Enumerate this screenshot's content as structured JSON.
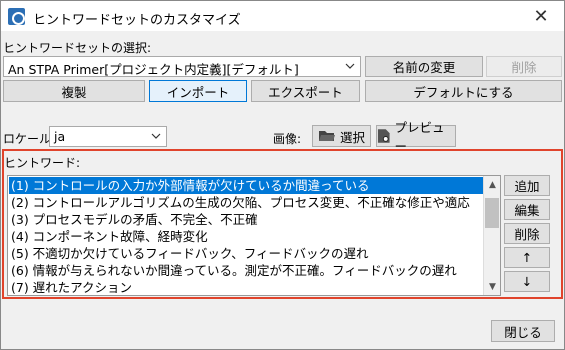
{
  "window": {
    "title": "ヒントワードセットのカスタマイズ"
  },
  "set_selection": {
    "label": "ヒントワードセットの選択:",
    "value": "An STPA Primer[プロジェクト内定義][デフォルト]",
    "rename_label": "名前の変更",
    "delete_label": "削除"
  },
  "toolbar": {
    "duplicate_label": "複製",
    "import_label": "インポート",
    "export_label": "エクスポート",
    "default_label": "デフォルトにする"
  },
  "locale": {
    "label": "ロケール:",
    "value": "ja"
  },
  "image": {
    "label": "画像:",
    "select_label": "選択",
    "preview_label": "プレビュー"
  },
  "hint_words": {
    "label": "ヒントワード:",
    "items": [
      "(1) コントロールの入力か外部情報が欠けているか間違っている",
      "(2) コントロールアルゴリズムの生成の欠陥、プロセス変更、不正確な修正や適応",
      "(3) プロセスモデルの矛盾、不完全、不正確",
      "(4) コンポーネント故障、経時変化",
      "(5) 不適切か欠けているフィードバック、フィードバックの遅れ",
      "(6) 情報が与えられないか間違っている。測定が不正確。フィードバックの遅れ",
      "(7) 遅れたアクション"
    ],
    "selected_index": 0,
    "add_label": "追加",
    "edit_label": "編集",
    "delete_label": "削除",
    "up_label": "↑",
    "down_label": "↓"
  },
  "footer": {
    "close_label": "閉じる"
  },
  "colors": {
    "accent": "#0078d7",
    "highlight_border": "#e0442c"
  }
}
